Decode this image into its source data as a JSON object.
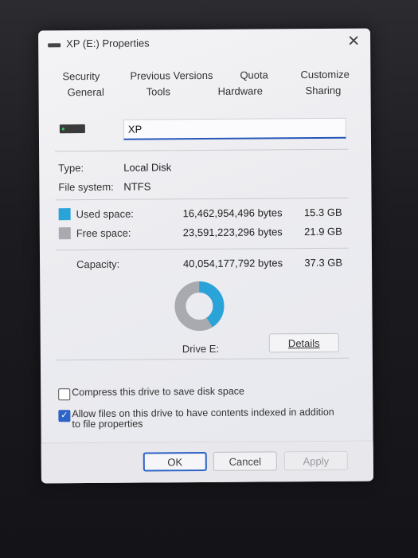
{
  "window": {
    "title": "XP (E:) Properties",
    "close_glyph": "✕"
  },
  "tabs": {
    "row1": [
      "Security",
      "Previous Versions",
      "Quota",
      "Customize"
    ],
    "row2": [
      "General",
      "Tools",
      "Hardware",
      "Sharing"
    ],
    "active": "General"
  },
  "general": {
    "drive_name_value": "XP",
    "type_label": "Type:",
    "type_value": "Local Disk",
    "fs_label": "File system:",
    "fs_value": "NTFS",
    "used": {
      "label": "Used space:",
      "bytes": "16,462,954,496 bytes",
      "size": "15.3 GB",
      "color": "#2aa3d8"
    },
    "free": {
      "label": "Free space:",
      "bytes": "23,591,223,296 bytes",
      "size": "21.9 GB",
      "color": "#a9a9b0"
    },
    "capacity": {
      "label": "Capacity:",
      "bytes": "40,054,177,792 bytes",
      "size": "37.3 GB"
    },
    "drive_label": "Drive E:",
    "details_button": "Details",
    "used_fraction": 0.411
  },
  "options": {
    "compress": {
      "label": "Compress this drive to save disk space",
      "checked": false
    },
    "index": {
      "label": "Allow files on this drive to have contents indexed in addition to file properties",
      "checked": true
    }
  },
  "footer": {
    "ok": "OK",
    "cancel": "Cancel",
    "apply": "Apply"
  }
}
